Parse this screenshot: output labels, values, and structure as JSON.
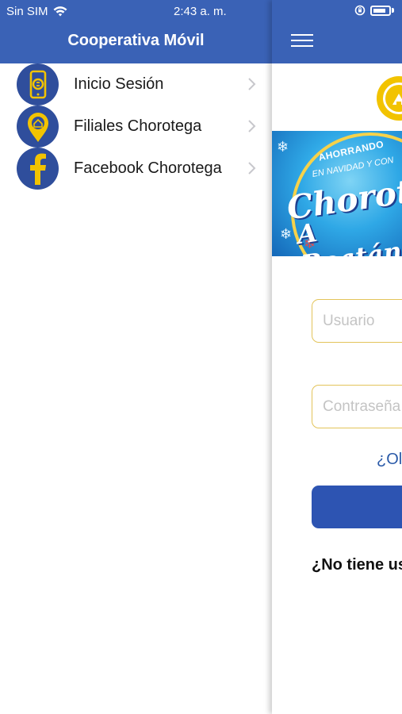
{
  "status_bar": {
    "carrier": "Sin SIM",
    "time": "2:43 a. m."
  },
  "drawer": {
    "title": "Cooperativa Móvil",
    "items": [
      {
        "label": "Inicio Sesión",
        "icon": "phone-login-icon"
      },
      {
        "label": "Filiales Chorotega",
        "icon": "location-pin-icon"
      },
      {
        "label": "Facebook Chorotega",
        "icon": "facebook-icon"
      }
    ]
  },
  "main": {
    "banner": {
      "line1": "AHORRANDO",
      "line2": "EN NAVIDAD Y CON",
      "line3": "Chorotega",
      "line4": "A Roatán"
    },
    "username_placeholder": "Usuario",
    "password_placeholder": "Contraseña",
    "forgot_text": "¿Olvidó su contraseña?",
    "register_text": "¿No tiene usuario?"
  },
  "colors": {
    "header_blue": "#3a62b6",
    "icon_circle": "#2f4e9c",
    "icon_yellow": "#f2c300",
    "field_border": "#e3c45a",
    "button_blue": "#2d54b2"
  }
}
